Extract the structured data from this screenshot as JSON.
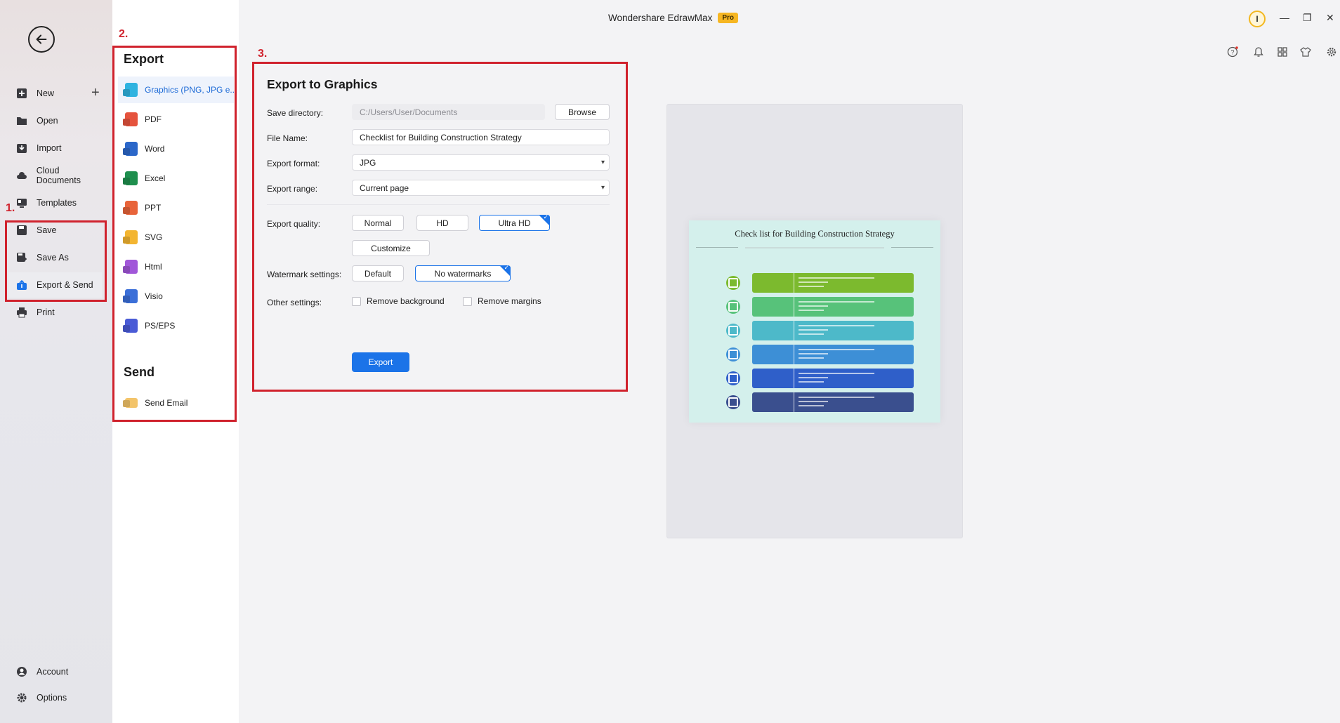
{
  "app": {
    "title": "Wondershare EdrawMax",
    "badge": "Pro",
    "avatar_initial": "I"
  },
  "sidebar": {
    "items": [
      {
        "label": "New",
        "icon": "plus-square-icon"
      },
      {
        "label": "Open",
        "icon": "folder-icon"
      },
      {
        "label": "Import",
        "icon": "import-icon"
      },
      {
        "label": "Cloud Documents",
        "icon": "cloud-icon"
      },
      {
        "label": "Templates",
        "icon": "templates-icon"
      },
      {
        "label": "Save",
        "icon": "save-icon"
      },
      {
        "label": "Save As",
        "icon": "save-as-icon"
      },
      {
        "label": "Export & Send",
        "icon": "export-icon"
      },
      {
        "label": "Print",
        "icon": "print-icon"
      },
      {
        "label": "Account",
        "icon": "account-icon"
      },
      {
        "label": "Options",
        "icon": "gear-icon"
      }
    ]
  },
  "export_menu": {
    "export_heading": "Export",
    "items": [
      {
        "label": "Graphics (PNG, JPG e...",
        "color": "#2fb3e0"
      },
      {
        "label": "PDF",
        "color": "#e5533d"
      },
      {
        "label": "Word",
        "color": "#2b67c9"
      },
      {
        "label": "Excel",
        "color": "#1f8f4e"
      },
      {
        "label": "PPT",
        "color": "#e8643a"
      },
      {
        "label": "SVG",
        "color": "#f3b531"
      },
      {
        "label": "Html",
        "color": "#a157d9"
      },
      {
        "label": "Visio",
        "color": "#3b6fd8"
      },
      {
        "label": "PS/EPS",
        "color": "#4a5bd6"
      }
    ],
    "send_heading": "Send",
    "send_items": [
      {
        "label": "Send Email",
        "color": "#f3c46a"
      }
    ]
  },
  "panel": {
    "title": "Export to Graphics",
    "save_directory_label": "Save directory:",
    "save_directory_value": "C:/Users/User/Documents",
    "browse_label": "Browse",
    "file_name_label": "File Name:",
    "file_name_value": "Checklist for Building Construction Strategy",
    "export_format_label": "Export format:",
    "export_format_value": "JPG",
    "export_range_label": "Export range:",
    "export_range_value": "Current page",
    "export_quality_label": "Export quality:",
    "quality_normal": "Normal",
    "quality_hd": "HD",
    "quality_ultra": "Ultra HD",
    "customize_label": "Customize",
    "watermark_label": "Watermark settings:",
    "watermark_default": "Default",
    "watermark_none": "No watermarks",
    "other_label": "Other settings:",
    "remove_background": "Remove background",
    "remove_margins": "Remove margins",
    "export_button": "Export"
  },
  "annotations": {
    "step1": "1.",
    "step2": "2.",
    "step3": "3."
  },
  "preview": {
    "title": "Check list for Building Construction Strategy",
    "row_colors": [
      "#7cba2e",
      "#57c27a",
      "#4db9c9",
      "#3d8fd6",
      "#2f5fc9",
      "#3a4f8e"
    ]
  },
  "accent_color": "#1b73e8",
  "highlight_color": "#d0222d"
}
